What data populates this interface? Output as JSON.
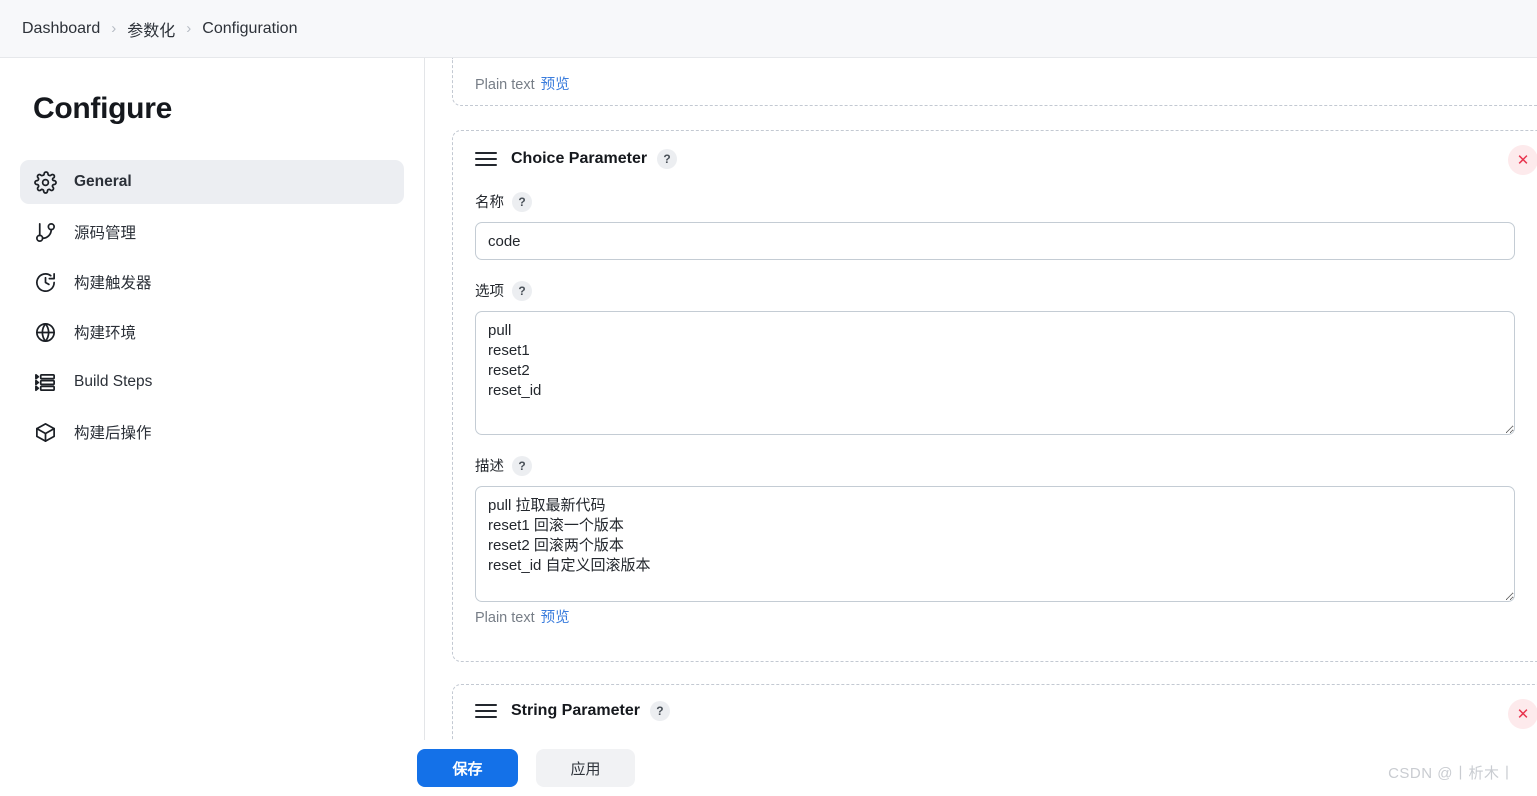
{
  "breadcrumb": {
    "items": [
      "Dashboard",
      "参数化",
      "Configuration"
    ],
    "separator": "›"
  },
  "sidebar": {
    "title": "Configure",
    "items": [
      {
        "label": "General",
        "icon": "gear-icon",
        "active": true
      },
      {
        "label": "源码管理",
        "icon": "git-branch-icon",
        "active": false
      },
      {
        "label": "构建触发器",
        "icon": "clock-icon",
        "active": false
      },
      {
        "label": "构建环境",
        "icon": "globe-icon",
        "active": false
      },
      {
        "label": "Build Steps",
        "icon": "list-icon",
        "active": false
      },
      {
        "label": "构建后操作",
        "icon": "box-icon",
        "active": false
      }
    ]
  },
  "top_partial": {
    "plain_text_label": "Plain text",
    "preview_link": "预览"
  },
  "choice_parameter": {
    "title": "Choice Parameter",
    "help": "?",
    "close": "✕",
    "name_field": {
      "label": "名称",
      "help": "?",
      "value": "code",
      "placeholder": ""
    },
    "choices_field": {
      "label": "选项",
      "help": "?",
      "value": "pull\nreset1\nreset2\nreset_id",
      "placeholder": ""
    },
    "description_field": {
      "label": "描述",
      "help": "?",
      "value": "pull 拉取最新代码\nreset1 回滚一个版本\nreset2 回滚两个版本\nreset_id 自定义回滚版本",
      "placeholder": ""
    },
    "plain_text_label": "Plain text",
    "preview_link": "预览"
  },
  "string_parameter": {
    "title": "String Parameter",
    "help": "?",
    "close": "✕"
  },
  "footer": {
    "save_label": "保存",
    "apply_label": "应用"
  },
  "watermark": "CSDN @丨析木丨",
  "colors": {
    "primary": "#1471e8",
    "link": "#3b7ddd",
    "danger": "#e8344e",
    "active_bg": "#eceef2"
  }
}
